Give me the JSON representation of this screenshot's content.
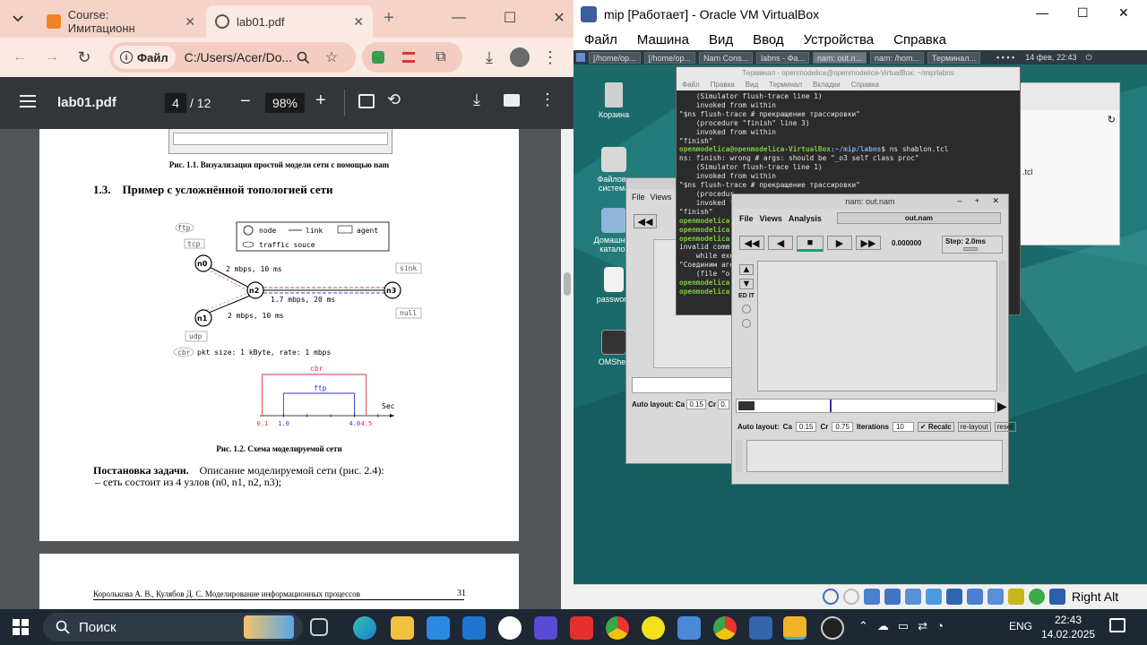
{
  "chrome": {
    "tabs": [
      {
        "label": "Course: Имитационн",
        "active": false
      },
      {
        "label": "lab01.pdf",
        "active": true
      }
    ],
    "site_chip": "Файл",
    "url": "C:/Users/Acer/Do...",
    "pdf": {
      "filename": "lab01.pdf",
      "page_current": "4",
      "page_total": "/ 12",
      "zoom": "98%",
      "fig11_caption": "Рис. 1.1. Визуализация простой модели сети с помощью nam",
      "section_heading": "1.3.    Пример с усложнённой топологией сети",
      "legend": {
        "node": "node",
        "link": "link",
        "agent": "agent",
        "traffic": "traffic souce"
      },
      "nodes": [
        "n0",
        "n1",
        "n2",
        "n3"
      ],
      "agents": {
        "ftp": "ftp",
        "tcp": "tcp",
        "udp": "udp",
        "cbr": "cbr",
        "sink": "sink",
        "null": "null"
      },
      "link_labels": [
        "2 mbps, 10 ms",
        "1.7 mbps, 20 ms",
        "2 mbps, 10 ms"
      ],
      "pkt_text": "pkt size: 1 kByte, rate: 1 mbps",
      "timeline": {
        "cbr": "cbr",
        "ftp": "ftp",
        "sec": "Sec",
        "ticks_red": [
          "0.1",
          "4.5"
        ],
        "ticks_blue": [
          "1.0",
          "4.0"
        ]
      },
      "fig12_caption": "Рис. 1.2. Схема моделируемой сети",
      "task_bold": "Постановка задачи.",
      "task_text": "Описание моделируемой сети (рис. 2.4):",
      "bullet": "–  сеть состоит из 4 узлов (n0, n1, n2, n3);",
      "footer_author": "Королькова А. В., Кулябов Д. С. Моделирование информационных процессов",
      "footer_page": "31"
    }
  },
  "vbox": {
    "title": "mip [Работает] - Oracle VM VirtualBox",
    "menu": [
      "Файл",
      "Машина",
      "Вид",
      "Ввод",
      "Устройства",
      "Справка"
    ],
    "right_alt": "Right Alt",
    "guest_panel": {
      "tasks": [
        "[/home/op...",
        "[/home/op...",
        "Nam Cons...",
        "labns - Фа...",
        "nam: out.n...",
        "nam: /hom...",
        "Терминал..."
      ],
      "clock": "14 фев, 22:43"
    },
    "desktop_icons": [
      "Корзина",
      "Файлова система",
      "Домашний каталог",
      "password",
      "OMShell"
    ],
    "terminal": {
      "title": "Терминал - openmodelica@openmodelica-VirtualBox: ~/mip/labns",
      "menu": [
        "Файл",
        "Правка",
        "Вид",
        "Терминал",
        "Вкладки",
        "Справка"
      ],
      "lines": [
        "    (Simulator flush-trace line 1)",
        "    invoked from within",
        "\"$ns flush-trace # прекращение трассировки\"",
        "    (procedure \"finish\" line 3)",
        "    invoked from within",
        "\"finish\""
      ],
      "prompt_user": "openmodelica@openmodelica-VirtualBox",
      "prompt_path": ":~/mip/labns",
      "prompt_cmd": "$ ns shablon.tcl",
      "lines2": [
        "ns: finish: wrong # args: should be \"_o3 self class proc\"",
        "    (Simulator flush-trace line 1)",
        "    invoked from within",
        "\"$ns flush-trace # прекращение трассировки\"",
        "    (procedur",
        "    invoked f",
        "\"finish\""
      ],
      "partial": [
        "openmodelica",
        "openmodelica",
        "openmodelica",
        "invalid comm",
        "    while exe",
        "\"Соединим аге",
        "    (file \"o",
        "openmodelica",
        "openmodelica"
      ]
    },
    "nam_back": {
      "menu": [
        "File",
        "Views"
      ],
      "auto_layout": "Auto layout:",
      "ca": "Ca",
      "ca_val": "0.15",
      "cr": "Cr",
      "cr_val": "0."
    },
    "nam": {
      "title": "nam: out.nam",
      "menu": [
        "File",
        "Views",
        "Analysis"
      ],
      "file_box": "out.nam",
      "time": "0.000000",
      "step": "Step: 2.0ms",
      "auto_layout": "Auto layout:",
      "ca": "Ca",
      "ca_val": "0.15",
      "cr": "Cr",
      "cr_val": "0.75",
      "iter": "Iterations",
      "iter_val": "10",
      "recalc": "Recalc",
      "relayout": "re-layout",
      "reset": "reset",
      "side_text": "ED IT"
    },
    "file_mgr_partial": ".tcl"
  },
  "taskbar": {
    "search": "Поиск",
    "lang": "ENG",
    "time": "22:43",
    "date": "14.02.2025"
  }
}
